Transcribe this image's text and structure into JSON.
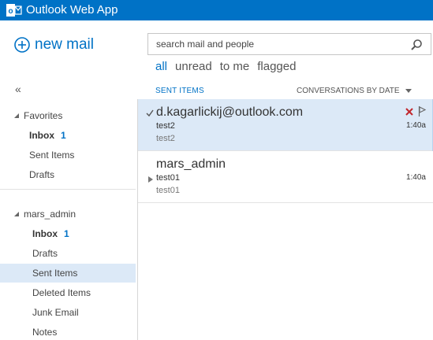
{
  "app": {
    "title": "Outlook Web App",
    "accent_color": "#0072c6",
    "logo_icon": "outlook-logo-icon"
  },
  "left_pane": {
    "new_mail_label": "new mail",
    "collapse_label": "«",
    "favorites": {
      "header": "Favorites",
      "items": [
        {
          "label": "Inbox",
          "count": "1",
          "bold": true
        },
        {
          "label": "Sent Items"
        },
        {
          "label": "Drafts"
        }
      ]
    },
    "account": {
      "header": "mars_admin",
      "items": [
        {
          "label": "Inbox",
          "count": "1",
          "bold": true
        },
        {
          "label": "Drafts"
        },
        {
          "label": "Sent Items",
          "selected": true
        },
        {
          "label": "Deleted Items"
        },
        {
          "label": "Junk Email"
        },
        {
          "label": "Notes"
        }
      ]
    }
  },
  "search": {
    "placeholder": "search mail and people",
    "icon": "search-icon"
  },
  "filters": [
    "all",
    "unread",
    "to me",
    "flagged"
  ],
  "active_filter": "all",
  "list": {
    "folder_title": "SENT ITEMS",
    "sort_label": "CONVERSATIONS BY DATE",
    "messages": [
      {
        "sender": "d.kagarlickij@outlook.com",
        "subject": "test2",
        "preview": "test2",
        "time": "1:40a",
        "selected": true
      },
      {
        "sender": "mars_admin",
        "subject": "test01",
        "preview": "test01",
        "time": "1:40a",
        "selected": false
      }
    ]
  }
}
